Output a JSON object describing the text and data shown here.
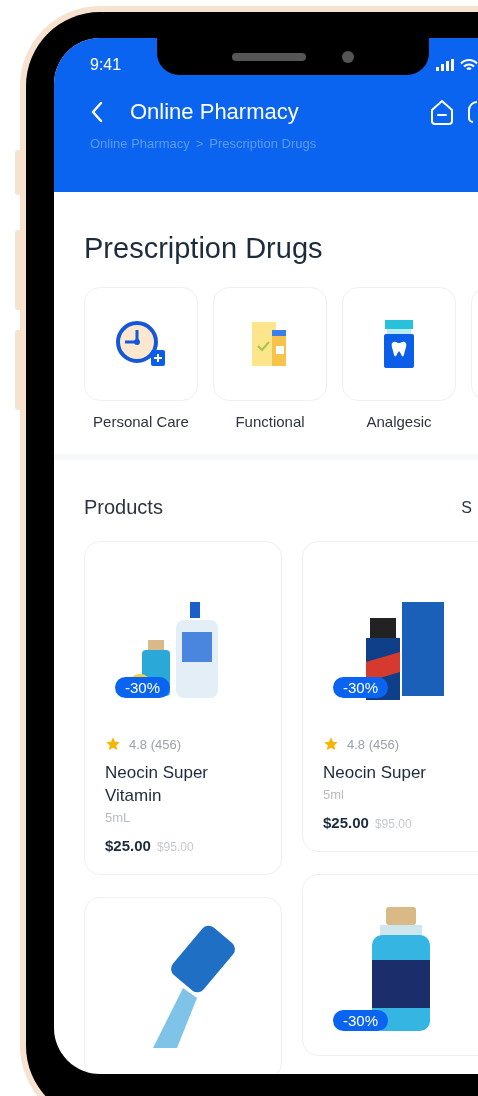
{
  "status_bar": {
    "time": "9:41"
  },
  "header": {
    "title": "Online Pharmacy",
    "breadcrumb": [
      {
        "label": "Online Pharmacy"
      },
      {
        "label": ">"
      },
      {
        "label": "Prescription Drugs"
      }
    ]
  },
  "category_section": {
    "title": "Prescription Drugs",
    "categories": [
      {
        "label": "Personal Care",
        "kind": "clock"
      },
      {
        "label": "Functional",
        "kind": "box"
      },
      {
        "label": "Analgesic",
        "kind": "tooth"
      },
      {
        "kind": "partial"
      }
    ]
  },
  "products_section": {
    "title": "Products",
    "link": "S",
    "columns": [
      [
        {
          "kind": "soap",
          "discount": "-30%",
          "rating": "4.8 (456)",
          "name": "Neocin Super Vitamin",
          "size": "5mL",
          "price": "$25.00",
          "old_price": "$95.00"
        },
        {
          "kind": "pills"
        }
      ],
      [
        {
          "kind": "serum",
          "discount": "-30%",
          "rating": "4.8 (456)",
          "name": "Neocin Super",
          "size": "5ml",
          "price": "$25.00",
          "old_price": "$95.00"
        },
        {
          "kind": "vial",
          "discount": "-30%"
        }
      ]
    ]
  }
}
